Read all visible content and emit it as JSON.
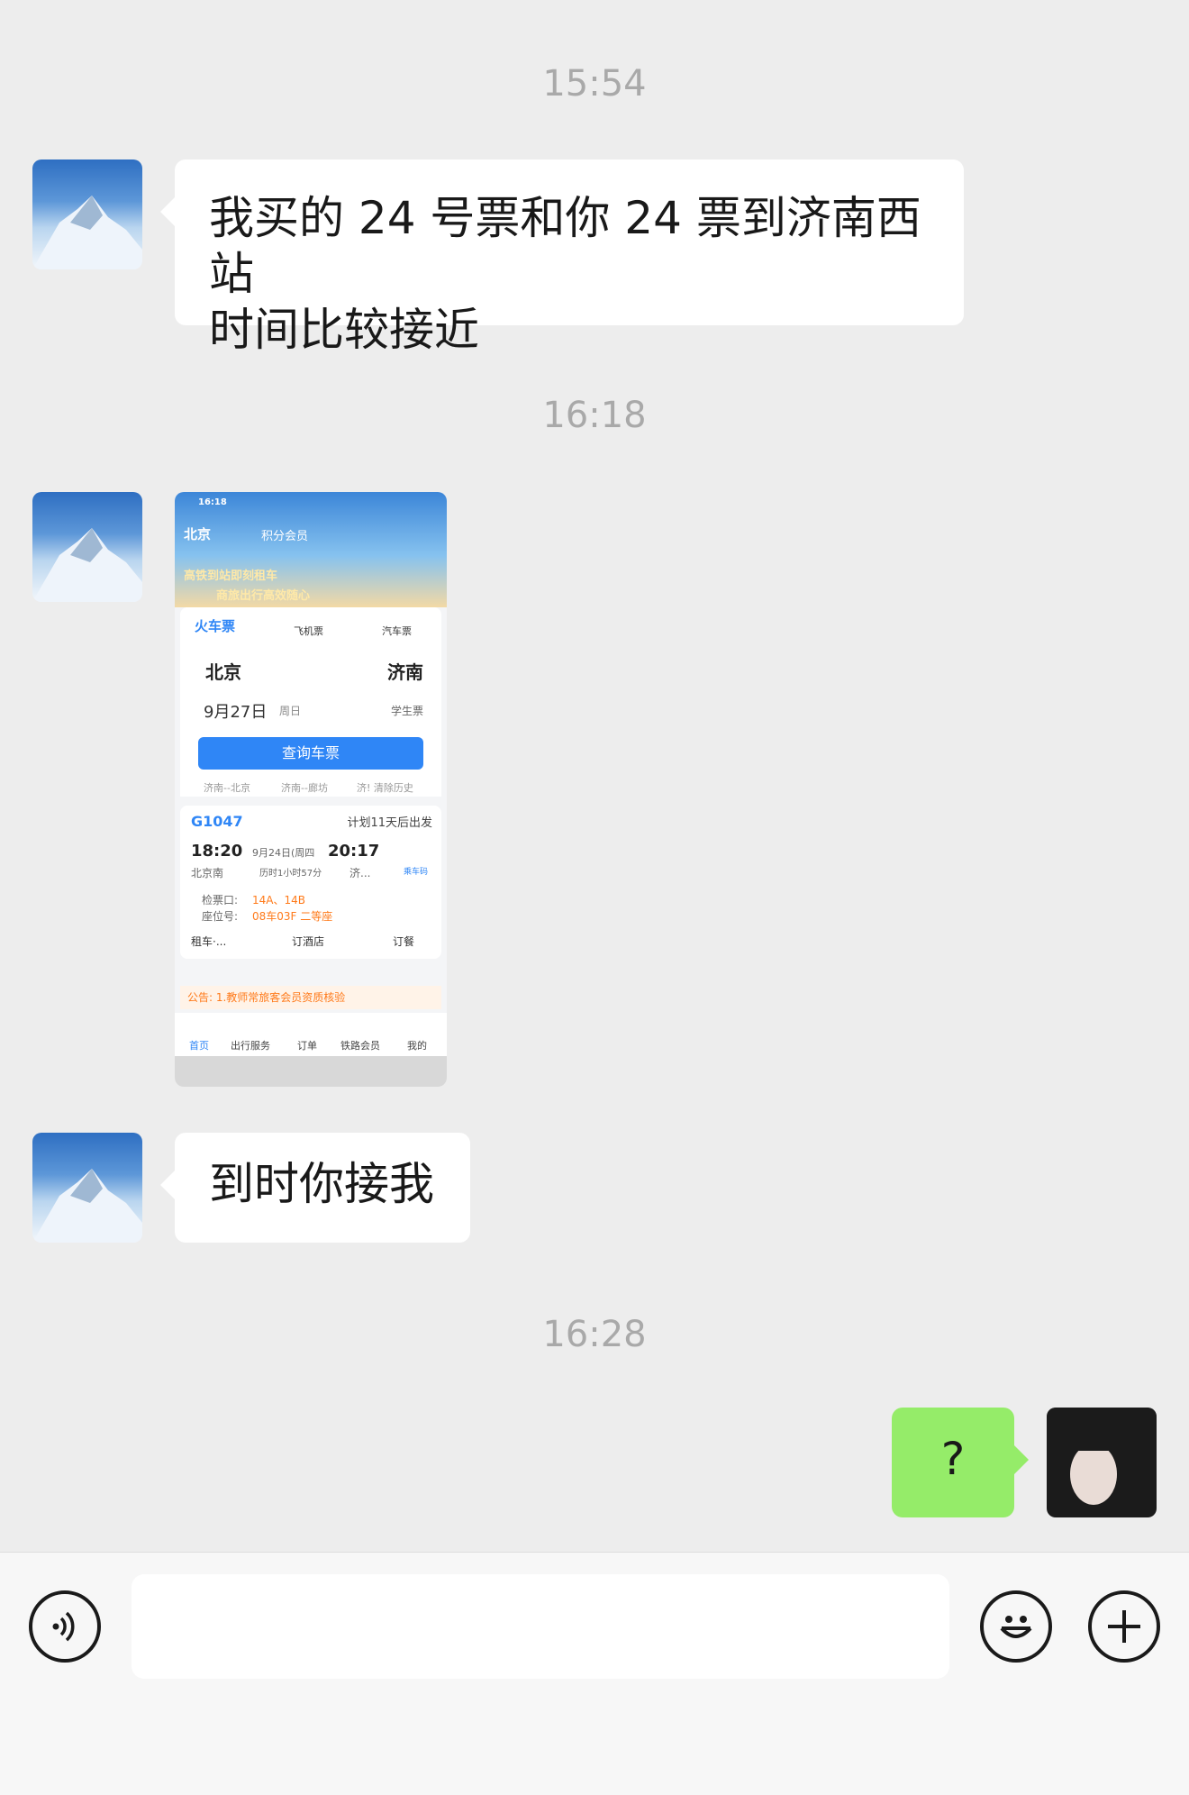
{
  "messages": {
    "t1": "15:54",
    "m1_line1": "我买的 24 号票和你 24 票到济南西站",
    "m1_line2": "时间比较接近",
    "t2": "16:18",
    "t3": "16:28",
    "m3": "到时你接我",
    "m4": "?"
  },
  "image_message": {
    "status_time": "16:18",
    "city_top": "北京",
    "search_hint": "积分会员",
    "banner_line1": "高铁到站即刻租车",
    "banner_line2": "商旅出行高效随心",
    "tab_train": "火车票",
    "tab_flight": "飞机票",
    "tab_bus": "汽车票",
    "from_city": "北京",
    "to_city": "济南",
    "date": "9月27日",
    "weekday": "周日",
    "student": "学生票",
    "query_button": "查询车票",
    "history_1": "济南--北京",
    "history_2": "济南--廊坊",
    "history_3": "济! 清除历史",
    "train_no": "G1047",
    "plan": "计划11天后出发",
    "dep_time": "18:20",
    "dep_date": "9月24日(周四",
    "arr_time": "20:17",
    "dep_station": "北京南",
    "duration": "历时1小时57分",
    "arr_station": "济...",
    "qr_label": "乘车码",
    "gate_label": "检票口:",
    "gate": "14A、14B",
    "seat_label": "座位号:",
    "seat": "08车03F 二等座",
    "svc_car": "租车·...",
    "svc_hotel": "订酒店",
    "svc_meal": "订餐",
    "notice": "公告: 1.教师常旅客会员资质核验",
    "nav_home": "首页",
    "nav_travel": "出行服务",
    "nav_order": "订单",
    "nav_member": "铁路会员",
    "nav_mine": "我的"
  },
  "colors": {
    "background": "#ededed",
    "bubble_left": "#ffffff",
    "bubble_right": "#95ec69",
    "timestamp": "#a9a9a9"
  },
  "icons": {
    "voice": "voice-icon",
    "emoji": "emoji-icon",
    "plus": "plus-icon"
  }
}
